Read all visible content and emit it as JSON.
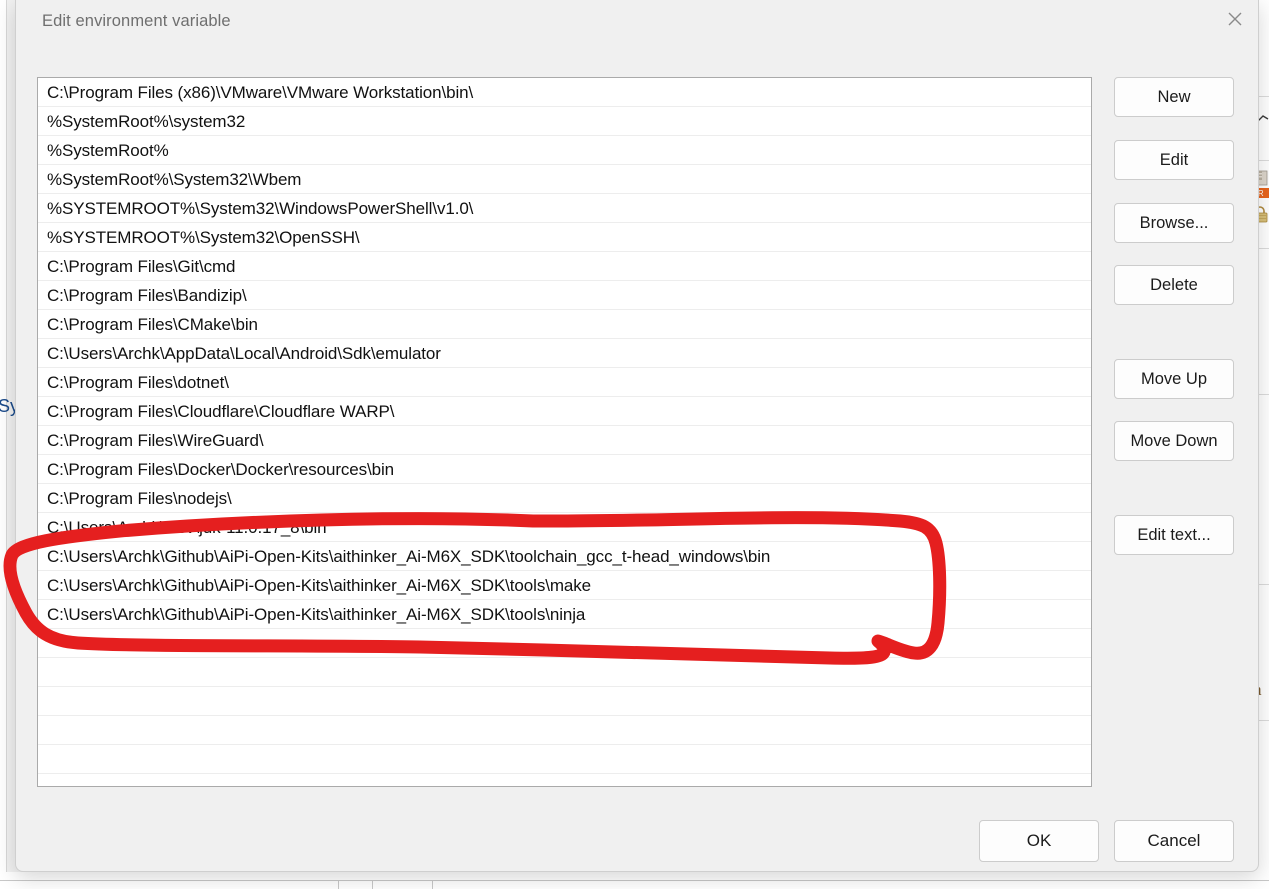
{
  "dialog": {
    "title": "Edit environment variable",
    "close_icon": "close-icon"
  },
  "path_list": {
    "entries": [
      "C:\\Program Files (x86)\\VMware\\VMware Workstation\\bin\\",
      "%SystemRoot%\\system32",
      "%SystemRoot%",
      "%SystemRoot%\\System32\\Wbem",
      "%SYSTEMROOT%\\System32\\WindowsPowerShell\\v1.0\\",
      "%SYSTEMROOT%\\System32\\OpenSSH\\",
      "C:\\Program Files\\Git\\cmd",
      "C:\\Program Files\\Bandizip\\",
      "C:\\Program Files\\CMake\\bin",
      "C:\\Users\\Archk\\AppData\\Local\\Android\\Sdk\\emulator",
      "C:\\Program Files\\dotnet\\",
      "C:\\Program Files\\Cloudflare\\Cloudflare WARP\\",
      "C:\\Program Files\\WireGuard\\",
      "C:\\Program Files\\Docker\\Docker\\resources\\bin",
      "C:\\Program Files\\nodejs\\",
      "C:\\Users\\Archk\\Dev\\jdk-11.0.17_8\\bin",
      "C:\\Users\\Archk\\Github\\AiPi-Open-Kits\\aithinker_Ai-M6X_SDK\\toolchain_gcc_t-head_windows\\bin",
      "C:\\Users\\Archk\\Github\\AiPi-Open-Kits\\aithinker_Ai-M6X_SDK\\tools\\make",
      "C:\\Users\\Archk\\Github\\AiPi-Open-Kits\\aithinker_Ai-M6X_SDK\\tools\\ninja"
    ],
    "empty_row_count": 6
  },
  "side_buttons": {
    "new": "New",
    "edit": "Edit",
    "browse": "Browse...",
    "delete": "Delete",
    "move_up": "Move Up",
    "move_down": "Move Down",
    "edit_text": "Edit text..."
  },
  "footer_buttons": {
    "ok": "OK",
    "cancel": "Cancel"
  },
  "annotation": {
    "name": "red-highlight-ellipse",
    "color": "#E51F1F",
    "highlighted_entries": [
      "C:\\Users\\Archk\\Github\\AiPi-Open-Kits\\aithinker_Ai-M6X_SDK\\toolchain_gcc_t-head_windows\\bin",
      "C:\\Users\\Archk\\Github\\AiPi-Open-Kits\\aithinker_Ai-M6X_SDK\\tools\\make",
      "C:\\Users\\Archk\\Github\\AiPi-Open-Kits\\aithinker_Ai-M6X_SDK\\tools\\ninja"
    ]
  },
  "background": {
    "left_fragment_text": "Sy",
    "right_fragment_text": "a"
  },
  "colors": {
    "dialog_background": "#F0F0F0",
    "list_background": "#FFFFFF",
    "text": "#111111",
    "title_text": "#6F6F6F",
    "button_border": "#CCCCCC",
    "annotation_red": "#E51F1F"
  }
}
